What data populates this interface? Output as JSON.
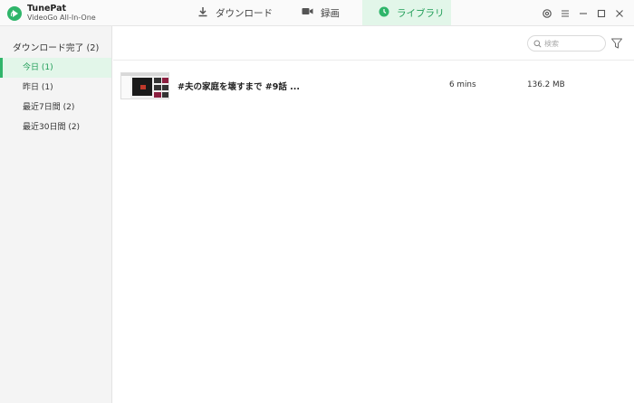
{
  "app": {
    "name": "TunePat",
    "subtitle": "VideoGo All-In-One",
    "accent": "#2fb56a"
  },
  "tabs": [
    {
      "label": "ダウンロード",
      "icon": "download-icon",
      "active": false
    },
    {
      "label": "録画",
      "icon": "video-camera-icon",
      "active": false
    },
    {
      "label": "ライブラリ",
      "icon": "clock-icon",
      "active": true
    }
  ],
  "window_controls": [
    "settings-icon",
    "menu-icon",
    "minimize-icon",
    "maximize-icon",
    "close-icon"
  ],
  "sidebar": {
    "title": "ダウンロード完了 (2)",
    "items": [
      {
        "label": "今日 (1)",
        "active": true
      },
      {
        "label": "昨日 (1)",
        "active": false
      },
      {
        "label": "最近7日間 (2)",
        "active": false
      },
      {
        "label": "最近30日間 (2)",
        "active": false
      }
    ]
  },
  "search": {
    "placeholder": "検索"
  },
  "rows": [
    {
      "title": "#夫の家庭を壊すまで #9話 ...",
      "duration": "6 mins",
      "size": "136.2 MB"
    }
  ]
}
